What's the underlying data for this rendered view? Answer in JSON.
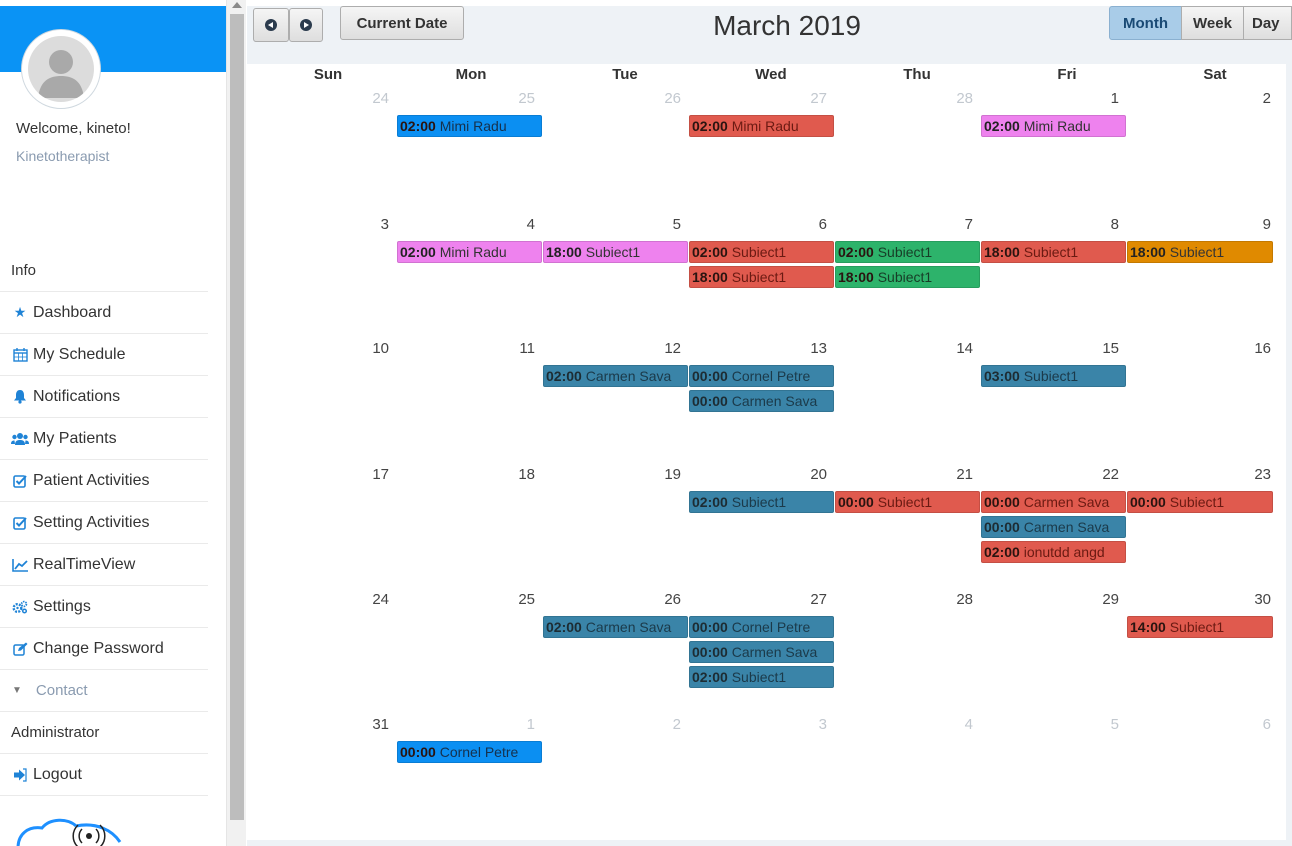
{
  "sidebar": {
    "welcome": "Welcome, kineto!",
    "role": "Kinetotherapist",
    "info_header": "Info",
    "items": [
      {
        "label": "Dashboard",
        "icon": "star-icon"
      },
      {
        "label": "My Schedule",
        "icon": "calendar-icon"
      },
      {
        "label": "Notifications",
        "icon": "bell-icon"
      },
      {
        "label": "My Patients",
        "icon": "users-icon"
      },
      {
        "label": "Patient Activities",
        "icon": "checkbox-icon"
      },
      {
        "label": "Setting Activities",
        "icon": "checkbox-icon"
      },
      {
        "label": "RealTimeView",
        "icon": "line-chart-icon"
      },
      {
        "label": "Settings",
        "icon": "gears-icon"
      },
      {
        "label": "Change Password",
        "icon": "edit-icon"
      }
    ],
    "contact_label": "Contact",
    "admin_header": "Administrator",
    "logout_label": "Logout"
  },
  "toolbar": {
    "current_date_label": "Current Date",
    "title": "March 2019",
    "views": {
      "month": "Month",
      "week": "Week",
      "day": "Day"
    }
  },
  "calendar": {
    "weekdays": [
      "Sun",
      "Mon",
      "Tue",
      "Wed",
      "Thu",
      "Fri",
      "Sat"
    ],
    "weeks": [
      [
        {
          "d": "24",
          "other": true
        },
        {
          "d": "25",
          "other": true
        },
        {
          "d": "26",
          "other": true
        },
        {
          "d": "27",
          "other": true
        },
        {
          "d": "28",
          "other": true
        },
        {
          "d": "1"
        },
        {
          "d": "2"
        }
      ],
      [
        {
          "d": "3"
        },
        {
          "d": "4"
        },
        {
          "d": "5"
        },
        {
          "d": "6"
        },
        {
          "d": "7"
        },
        {
          "d": "8"
        },
        {
          "d": "9"
        }
      ],
      [
        {
          "d": "10"
        },
        {
          "d": "11"
        },
        {
          "d": "12"
        },
        {
          "d": "13"
        },
        {
          "d": "14"
        },
        {
          "d": "15"
        },
        {
          "d": "16"
        }
      ],
      [
        {
          "d": "17"
        },
        {
          "d": "18"
        },
        {
          "d": "19"
        },
        {
          "d": "20"
        },
        {
          "d": "21"
        },
        {
          "d": "22"
        },
        {
          "d": "23"
        }
      ],
      [
        {
          "d": "24"
        },
        {
          "d": "25"
        },
        {
          "d": "26"
        },
        {
          "d": "27"
        },
        {
          "d": "28"
        },
        {
          "d": "29"
        },
        {
          "d": "30"
        }
      ],
      [
        {
          "d": "31"
        },
        {
          "d": "1",
          "other": true
        },
        {
          "d": "2",
          "other": true
        },
        {
          "d": "3",
          "other": true
        },
        {
          "d": "4",
          "other": true
        },
        {
          "d": "5",
          "other": true
        },
        {
          "d": "6",
          "other": true
        }
      ]
    ],
    "events": [
      {
        "week": 0,
        "day": 1,
        "slot": 0,
        "time": "02:00",
        "title": "Mimi Radu",
        "color": "#0b8ff2"
      },
      {
        "week": 0,
        "day": 3,
        "slot": 0,
        "time": "02:00",
        "title": "Mimi Radu",
        "color": "#e05a4e"
      },
      {
        "week": 0,
        "day": 5,
        "slot": 0,
        "time": "02:00",
        "title": "Mimi Radu",
        "color": "#ee82ee"
      },
      {
        "week": 1,
        "day": 1,
        "slot": 0,
        "time": "02:00",
        "title": "Mimi Radu",
        "color": "#ee82ee"
      },
      {
        "week": 1,
        "day": 2,
        "slot": 0,
        "time": "18:00",
        "title": "Subiect1",
        "color": "#ee82ee"
      },
      {
        "week": 1,
        "day": 3,
        "slot": 0,
        "time": "02:00",
        "title": "Subiect1",
        "color": "#e05a4e"
      },
      {
        "week": 1,
        "day": 3,
        "slot": 1,
        "time": "18:00",
        "title": "Subiect1",
        "color": "#e05a4e"
      },
      {
        "week": 1,
        "day": 4,
        "slot": 0,
        "time": "02:00",
        "title": "Subiect1",
        "color": "#2db36b"
      },
      {
        "week": 1,
        "day": 4,
        "slot": 1,
        "time": "18:00",
        "title": "Subiect1",
        "color": "#2db36b"
      },
      {
        "week": 1,
        "day": 5,
        "slot": 0,
        "time": "18:00",
        "title": "Subiect1",
        "color": "#e05a4e"
      },
      {
        "week": 1,
        "day": 6,
        "slot": 0,
        "time": "18:00",
        "title": "Subiect1",
        "color": "#e08a00"
      },
      {
        "week": 2,
        "day": 2,
        "slot": 0,
        "time": "02:00",
        "title": "Carmen Sava",
        "color": "#3a84a8"
      },
      {
        "week": 2,
        "day": 3,
        "slot": 0,
        "time": "00:00",
        "title": "Cornel Petre",
        "color": "#3a84a8"
      },
      {
        "week": 2,
        "day": 3,
        "slot": 1,
        "time": "00:00",
        "title": "Carmen Sava",
        "color": "#3a84a8"
      },
      {
        "week": 2,
        "day": 5,
        "slot": 0,
        "time": "03:00",
        "title": "Subiect1",
        "color": "#3a84a8"
      },
      {
        "week": 3,
        "day": 3,
        "slot": 0,
        "time": "02:00",
        "title": "Subiect1",
        "color": "#3a84a8"
      },
      {
        "week": 3,
        "day": 4,
        "slot": 0,
        "time": "00:00",
        "title": "Subiect1",
        "color": "#e05a4e"
      },
      {
        "week": 3,
        "day": 5,
        "slot": 0,
        "time": "00:00",
        "title": "Carmen Sava",
        "color": "#e05a4e"
      },
      {
        "week": 3,
        "day": 5,
        "slot": 1,
        "time": "00:00",
        "title": "Carmen Sava",
        "color": "#3a84a8"
      },
      {
        "week": 3,
        "day": 5,
        "slot": 2,
        "time": "02:00",
        "title": "ionutdd angd",
        "color": "#e05a4e"
      },
      {
        "week": 3,
        "day": 6,
        "slot": 0,
        "time": "00:00",
        "title": "Subiect1",
        "color": "#e05a4e"
      },
      {
        "week": 4,
        "day": 2,
        "slot": 0,
        "time": "02:00",
        "title": "Carmen Sava",
        "color": "#3a84a8"
      },
      {
        "week": 4,
        "day": 3,
        "slot": 0,
        "time": "00:00",
        "title": "Cornel Petre",
        "color": "#3a84a8"
      },
      {
        "week": 4,
        "day": 3,
        "slot": 1,
        "time": "00:00",
        "title": "Carmen Sava",
        "color": "#3a84a8"
      },
      {
        "week": 4,
        "day": 3,
        "slot": 2,
        "time": "02:00",
        "title": "Subiect1",
        "color": "#3a84a8"
      },
      {
        "week": 4,
        "day": 6,
        "slot": 0,
        "time": "14:00",
        "title": "Subiect1",
        "color": "#e05a4e"
      },
      {
        "week": 5,
        "day": 1,
        "slot": 0,
        "time": "00:00",
        "title": "Cornel Petre",
        "color": "#0b8ff2"
      }
    ]
  }
}
